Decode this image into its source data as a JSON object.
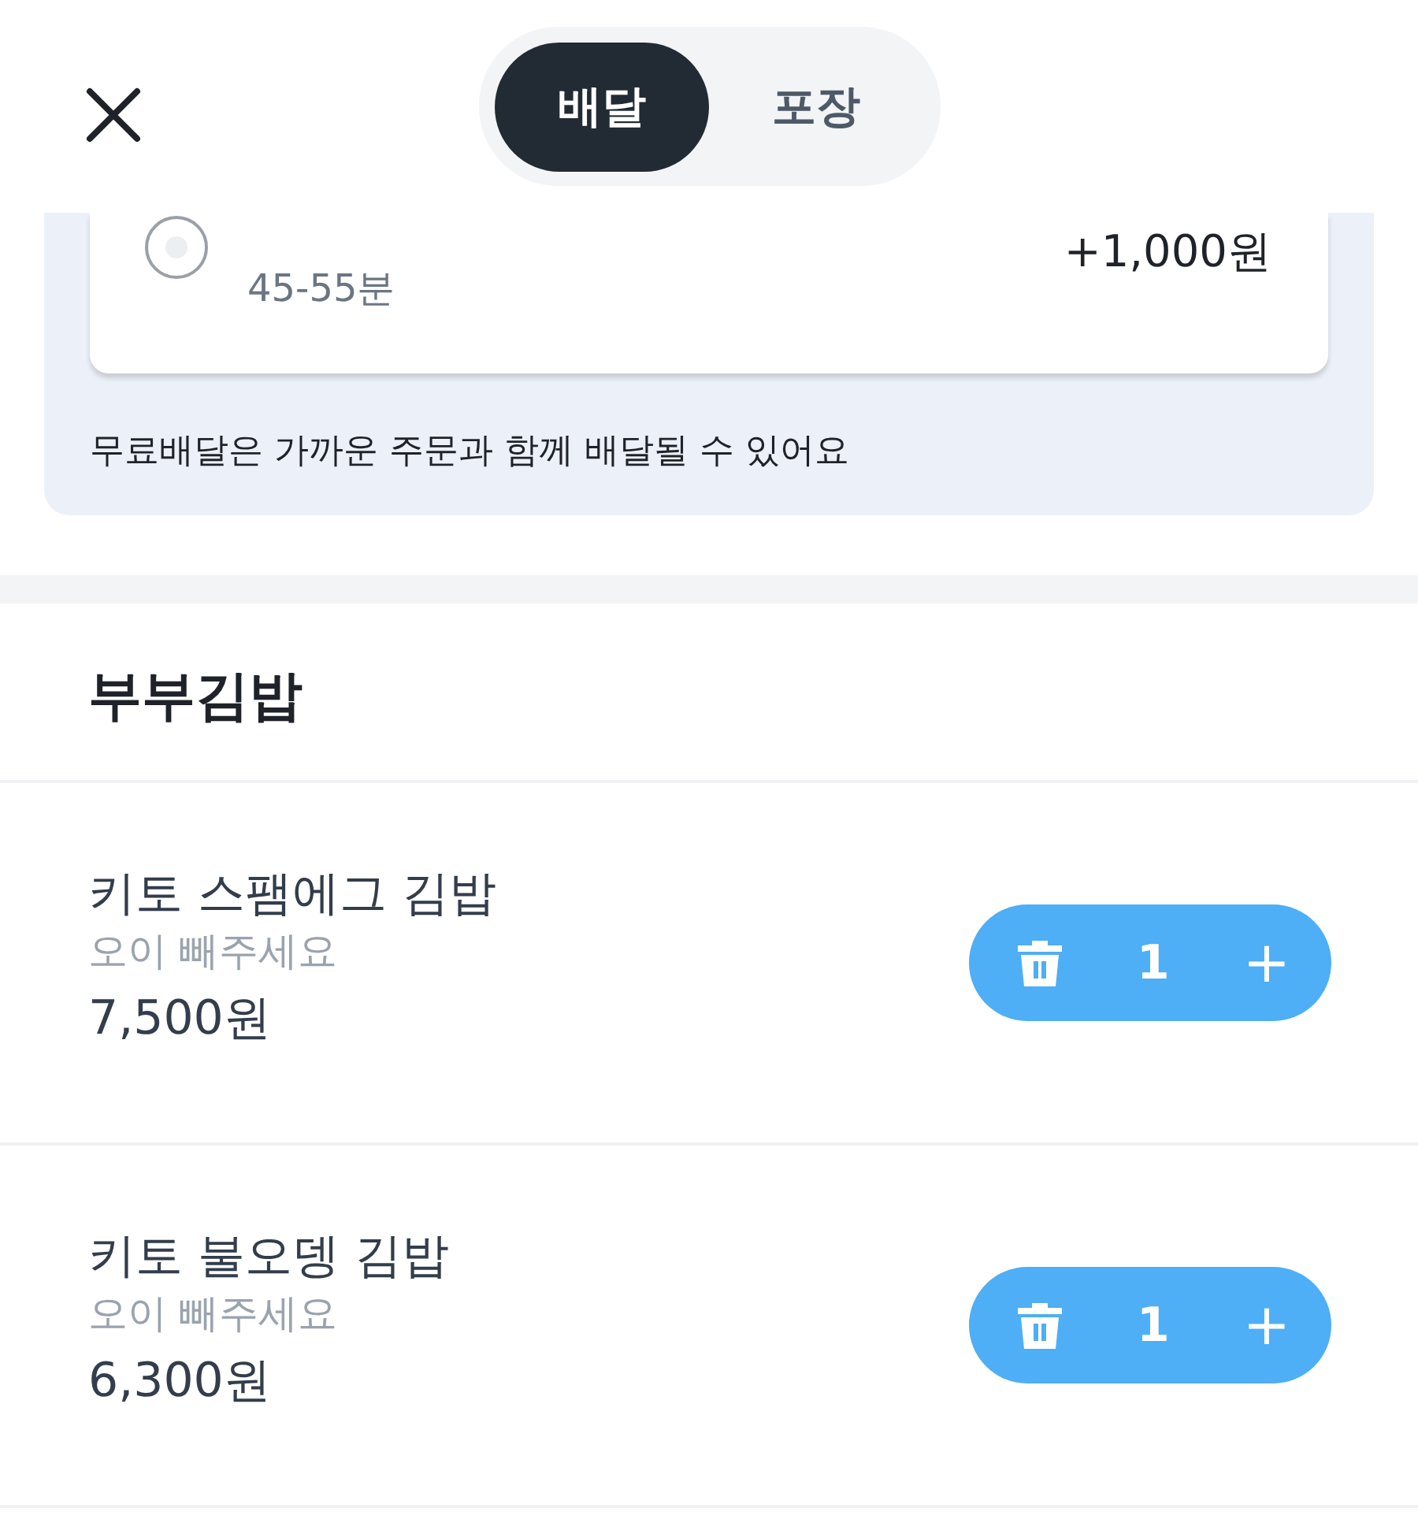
{
  "tabs": [
    {
      "label": "배달",
      "selected": true
    },
    {
      "label": "포장",
      "selected": false
    }
  ],
  "delivery_option": {
    "selected": false,
    "time": "45-55분",
    "price": "+1,000원"
  },
  "notice": "무료배달은 가까운 주문과 함께 배달될 수 있어요",
  "store": {
    "name": "부부김밥"
  },
  "items": [
    {
      "name": "키토 스팸에그 김밥",
      "option": "오이 빼주세요",
      "price": "7,500원",
      "quantity": "1",
      "plus": "+"
    },
    {
      "name": "키토 불오뎅 김밥",
      "option": "오이 빼주세요",
      "price": "6,300원",
      "quantity": "1",
      "plus": "+"
    }
  ]
}
